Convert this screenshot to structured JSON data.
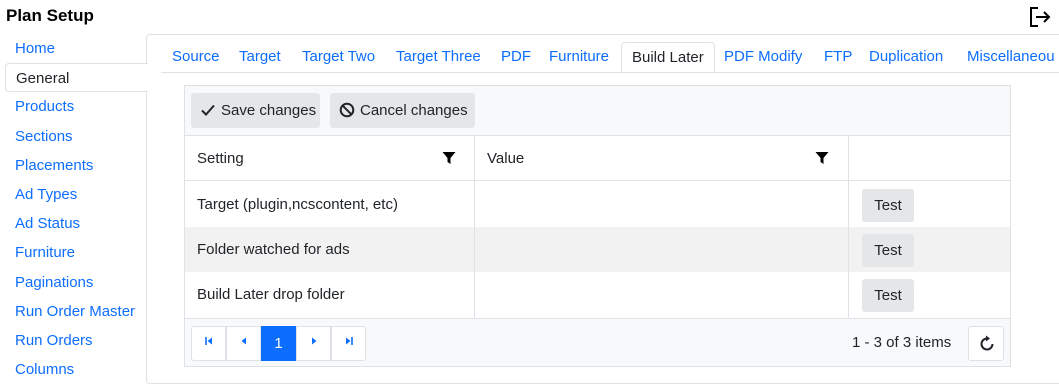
{
  "app": {
    "title": "Plan Setup"
  },
  "sidebar": {
    "items": [
      {
        "label": "Home"
      },
      {
        "label": "General",
        "active": true
      },
      {
        "label": "Products"
      },
      {
        "label": "Sections"
      },
      {
        "label": "Placements"
      },
      {
        "label": "Ad Types"
      },
      {
        "label": "Ad Status"
      },
      {
        "label": "Furniture"
      },
      {
        "label": "Paginations"
      },
      {
        "label": "Run Order Master"
      },
      {
        "label": "Run Orders"
      },
      {
        "label": "Columns"
      }
    ]
  },
  "tabs": [
    {
      "label": "Source"
    },
    {
      "label": "Target"
    },
    {
      "label": "Target Two"
    },
    {
      "label": "Target Three"
    },
    {
      "label": "PDF"
    },
    {
      "label": "Furniture"
    },
    {
      "label": "Build Later",
      "active": true
    },
    {
      "label": "PDF Modify"
    },
    {
      "label": "FTP"
    },
    {
      "label": "Duplication"
    },
    {
      "label": "Miscellaneou"
    }
  ],
  "toolbar": {
    "save_label": "Save changes",
    "cancel_label": "Cancel changes"
  },
  "table": {
    "columns": [
      {
        "label": "Setting"
      },
      {
        "label": "Value"
      }
    ],
    "rows": [
      {
        "setting": "Target (plugin,ncscontent, etc)",
        "value": "",
        "action": "Test"
      },
      {
        "setting": "Folder watched for ads",
        "value": "",
        "action": "Test"
      },
      {
        "setting": "Build Later drop folder",
        "value": "",
        "action": "Test"
      }
    ]
  },
  "pager": {
    "current_page": "1",
    "info": "1 - 3 of 3 items"
  },
  "icons": {
    "logout": "logout-icon",
    "save": "check-icon",
    "cancel": "ban-icon",
    "filter": "filter-icon",
    "refresh": "refresh-icon"
  },
  "colors": {
    "link": "#0d6efd",
    "active_page": "#0d6efd",
    "toolbar_bg": "#f8f9fa",
    "button_bg": "#e4e6e8",
    "alt_row": "#f2f2f2",
    "border": "#dee2e6"
  }
}
